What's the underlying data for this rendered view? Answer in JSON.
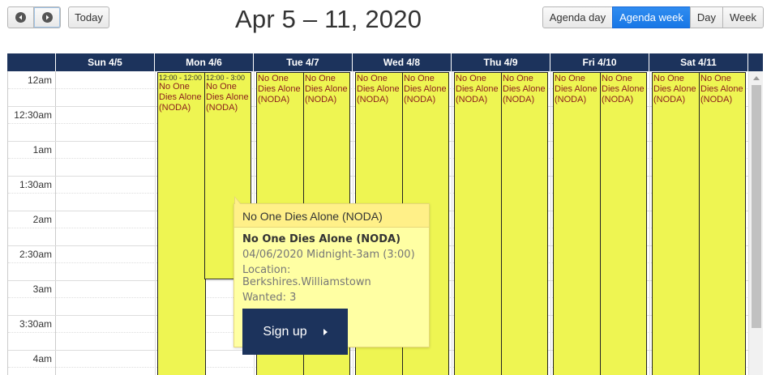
{
  "toolbar": {
    "prev_icon": "chevron-left-icon",
    "next_icon": "chevron-right-icon",
    "today_label": "Today",
    "title": "Apr 5 – 11, 2020",
    "views": [
      {
        "label": "Agenda day",
        "active": false
      },
      {
        "label": "Agenda week",
        "active": true
      },
      {
        "label": "Day",
        "active": false
      },
      {
        "label": "Week",
        "active": false
      }
    ]
  },
  "header": {
    "days": [
      "Sun 4/5",
      "Mon 4/6",
      "Tue 4/7",
      "Wed 4/8",
      "Thu 4/9",
      "Fri 4/10",
      "Sat 4/11"
    ]
  },
  "time_labels": [
    "12am",
    "12:30am",
    "1am",
    "1:30am",
    "2am",
    "2:30am",
    "3am",
    "3:30am",
    "4am"
  ],
  "events": {
    "mon_left_time": "12:00 - 12:00",
    "mon_left_title": "No One Dies Alone (NODA)",
    "mon_right_time": "12:00 - 3:00",
    "mon_right_title": "No One Dies Alone (NODA)",
    "generic_title": "No One Dies Alone (NODA)"
  },
  "popover": {
    "header": "No One Dies Alone (NODA)",
    "title": "No One Dies Alone (NODA)",
    "date_line": "04/06/2020 Midnight-3am (3:00)",
    "location_line": "Location: Berkshires.Williamstown",
    "wanted_line": "Wanted: 3",
    "signup_label": "Sign up"
  },
  "colors": {
    "header_bg": "#1c335c",
    "event_bg": "#eef552",
    "event_text": "#8a1d1d",
    "popover_bg": "#ffffa3",
    "active_view": "#1877e6"
  }
}
